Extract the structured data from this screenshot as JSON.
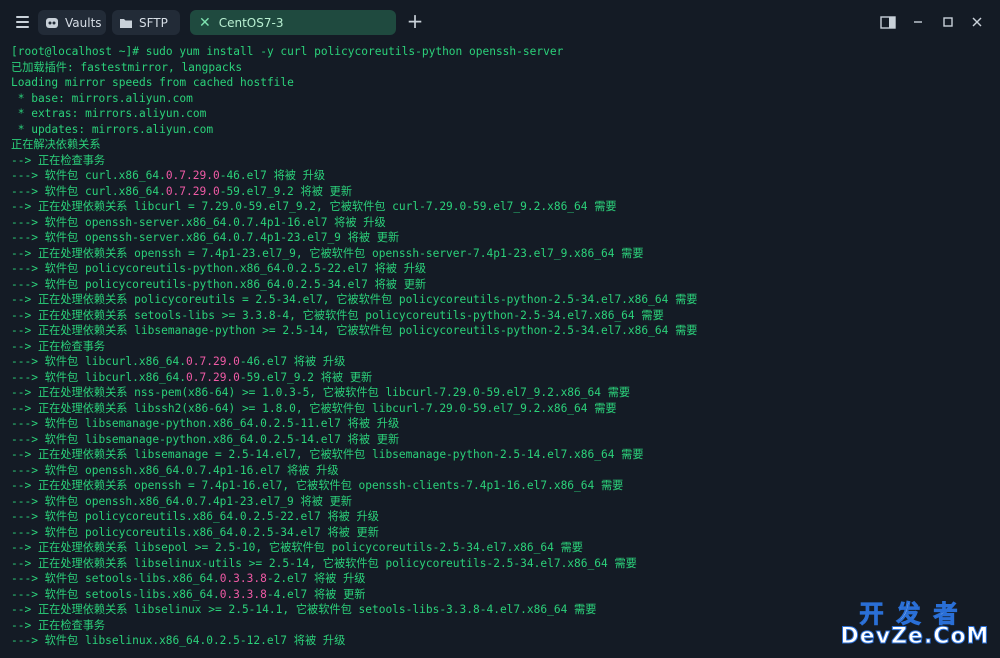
{
  "tabs": [
    {
      "label": "Vaults",
      "icon": "vault-icon"
    },
    {
      "label": "SFTP",
      "icon": "folder-icon"
    },
    {
      "label": "CentOS7-3",
      "icon": "close-icon",
      "active": true
    }
  ],
  "colors": {
    "prompt": "#2bd17a",
    "highlight": "#ef5aa5",
    "background": "#141b25",
    "active_tab": "#1f4a3f"
  },
  "terminal": {
    "lines": [
      [
        {
          "t": "[root@localhost ~]# sudo yum install -y curl policycoreutils-python openssh-server",
          "c": "text"
        }
      ],
      [
        {
          "t": "已加载插件: fastestmirror, langpacks",
          "c": "text"
        }
      ],
      [
        {
          "t": "Loading mirror speeds from cached hostfile",
          "c": "text"
        }
      ],
      [
        {
          "t": " * base: mirrors.aliyun.com",
          "c": "text"
        }
      ],
      [
        {
          "t": " * extras: mirrors.aliyun.com",
          "c": "text"
        }
      ],
      [
        {
          "t": " * updates: mirrors.aliyun.com",
          "c": "text"
        }
      ],
      [
        {
          "t": "正在解决依赖关系",
          "c": "text"
        }
      ],
      [
        {
          "t": "--> 正在检查事务",
          "c": "text"
        }
      ],
      [
        {
          "t": "---> 软件包 curl.x86_64.",
          "c": "text"
        },
        {
          "t": "0.7.29.0",
          "c": "hl"
        },
        {
          "t": "-46.el7 将被 升级",
          "c": "text"
        }
      ],
      [
        {
          "t": "---> 软件包 curl.x86_64.",
          "c": "text"
        },
        {
          "t": "0.7.29.0",
          "c": "hl"
        },
        {
          "t": "-59.el7_9.2 将被 更新",
          "c": "text"
        }
      ],
      [
        {
          "t": "--> 正在处理依赖关系 libcurl = 7.29.0-59.el7_9.2, 它被软件包 curl-7.29.0-59.el7_9.2.x86_64 需要",
          "c": "text"
        }
      ],
      [
        {
          "t": "---> 软件包 openssh-server.x86_64.0.7.4p1-16.el7 将被 升级",
          "c": "text"
        }
      ],
      [
        {
          "t": "---> 软件包 openssh-server.x86_64.0.7.4p1-23.el7_9 将被 更新",
          "c": "text"
        }
      ],
      [
        {
          "t": "--> 正在处理依赖关系 openssh = 7.4p1-23.el7_9, 它被软件包 openssh-server-7.4p1-23.el7_9.x86_64 需要",
          "c": "text"
        }
      ],
      [
        {
          "t": "---> 软件包 policycoreutils-python.x86_64.0.2.5-22.el7 将被 升级",
          "c": "text"
        }
      ],
      [
        {
          "t": "---> 软件包 policycoreutils-python.x86_64.0.2.5-34.el7 将被 更新",
          "c": "text"
        }
      ],
      [
        {
          "t": "--> 正在处理依赖关系 policycoreutils = 2.5-34.el7, 它被软件包 policycoreutils-python-2.5-34.el7.x86_64 需要",
          "c": "text"
        }
      ],
      [
        {
          "t": "--> 正在处理依赖关系 setools-libs >= 3.3.8-4, 它被软件包 policycoreutils-python-2.5-34.el7.x86_64 需要",
          "c": "text"
        }
      ],
      [
        {
          "t": "--> 正在处理依赖关系 libsemanage-python >= 2.5-14, 它被软件包 policycoreutils-python-2.5-34.el7.x86_64 需要",
          "c": "text"
        }
      ],
      [
        {
          "t": "--> 正在检查事务",
          "c": "text"
        }
      ],
      [
        {
          "t": "---> 软件包 libcurl.x86_64.",
          "c": "text"
        },
        {
          "t": "0.7.29.0",
          "c": "hl"
        },
        {
          "t": "-46.el7 将被 升级",
          "c": "text"
        }
      ],
      [
        {
          "t": "---> 软件包 libcurl.x86_64.",
          "c": "text"
        },
        {
          "t": "0.7.29.0",
          "c": "hl"
        },
        {
          "t": "-59.el7_9.2 将被 更新",
          "c": "text"
        }
      ],
      [
        {
          "t": "--> 正在处理依赖关系 nss-pem(x86-64) >= 1.0.3-5, 它被软件包 libcurl-7.29.0-59.el7_9.2.x86_64 需要",
          "c": "text"
        }
      ],
      [
        {
          "t": "--> 正在处理依赖关系 libssh2(x86-64) >= 1.8.0, 它被软件包 libcurl-7.29.0-59.el7_9.2.x86_64 需要",
          "c": "text"
        }
      ],
      [
        {
          "t": "---> 软件包 libsemanage-python.x86_64.0.2.5-11.el7 将被 升级",
          "c": "text"
        }
      ],
      [
        {
          "t": "---> 软件包 libsemanage-python.x86_64.0.2.5-14.el7 将被 更新",
          "c": "text"
        }
      ],
      [
        {
          "t": "--> 正在处理依赖关系 libsemanage = 2.5-14.el7, 它被软件包 libsemanage-python-2.5-14.el7.x86_64 需要",
          "c": "text"
        }
      ],
      [
        {
          "t": "---> 软件包 openssh.x86_64.0.7.4p1-16.el7 将被 升级",
          "c": "text"
        }
      ],
      [
        {
          "t": "--> 正在处理依赖关系 openssh = 7.4p1-16.el7, 它被软件包 openssh-clients-7.4p1-16.el7.x86_64 需要",
          "c": "text"
        }
      ],
      [
        {
          "t": "---> 软件包 openssh.x86_64.0.7.4p1-23.el7_9 将被 更新",
          "c": "text"
        }
      ],
      [
        {
          "t": "---> 软件包 policycoreutils.x86_64.0.2.5-22.el7 将被 升级",
          "c": "text"
        }
      ],
      [
        {
          "t": "---> 软件包 policycoreutils.x86_64.0.2.5-34.el7 将被 更新",
          "c": "text"
        }
      ],
      [
        {
          "t": "--> 正在处理依赖关系 libsepol >= 2.5-10, 它被软件包 policycoreutils-2.5-34.el7.x86_64 需要",
          "c": "text"
        }
      ],
      [
        {
          "t": "--> 正在处理依赖关系 libselinux-utils >= 2.5-14, 它被软件包 policycoreutils-2.5-34.el7.x86_64 需要",
          "c": "text"
        }
      ],
      [
        {
          "t": "---> 软件包 setools-libs.x86_64.",
          "c": "text"
        },
        {
          "t": "0.3.3.8",
          "c": "hl"
        },
        {
          "t": "-2.el7 将被 升级",
          "c": "text"
        }
      ],
      [
        {
          "t": "---> 软件包 setools-libs.x86_64.",
          "c": "text"
        },
        {
          "t": "0.3.3.8",
          "c": "hl"
        },
        {
          "t": "-4.el7 将被 更新",
          "c": "text"
        }
      ],
      [
        {
          "t": "--> 正在处理依赖关系 libselinux >= 2.5-14.1, 它被软件包 setools-libs-3.3.8-4.el7.x86_64 需要",
          "c": "text"
        }
      ],
      [
        {
          "t": "--> 正在检查事务",
          "c": "text"
        }
      ],
      [
        {
          "t": "---> 软件包 libselinux.x86_64.0.2.5-12.el7 将被 升级",
          "c": "text"
        }
      ]
    ]
  },
  "watermark": {
    "top": "开发者",
    "bottom": "DevZe.CoM"
  }
}
